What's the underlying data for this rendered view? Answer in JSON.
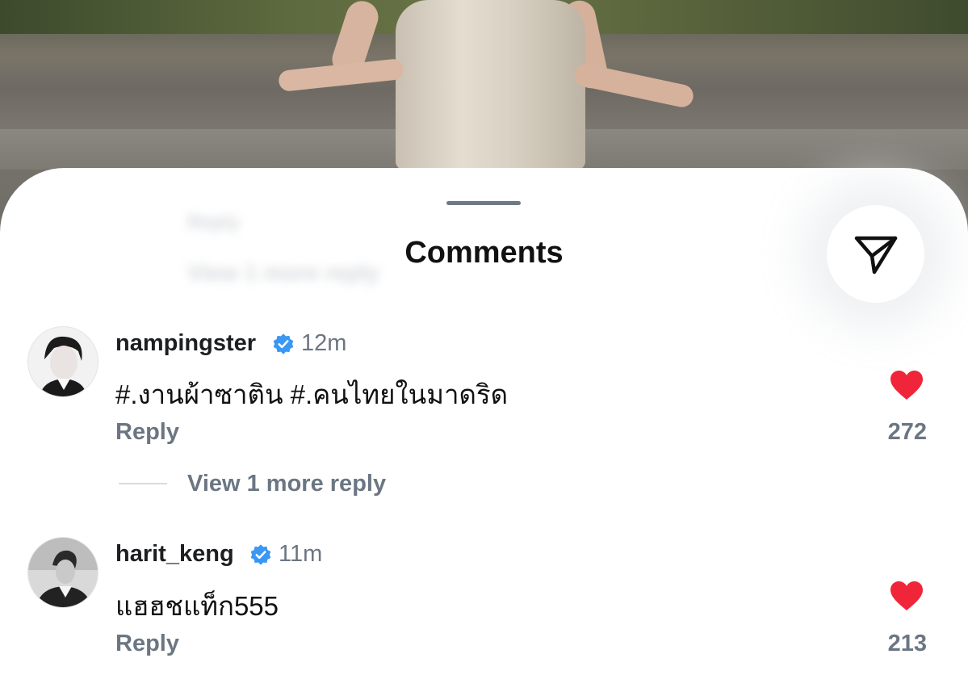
{
  "sheet": {
    "title": "Comments",
    "ghost_reply": "Reply",
    "ghost_more": "View 1 more reply"
  },
  "comments": [
    {
      "username": "nampingster",
      "time": "12m",
      "text": "#.งานผ้าซาติน #.คนไทยในมาดริด",
      "reply_label": "Reply",
      "likes": "272",
      "more_replies": "View 1 more reply"
    },
    {
      "username": "harit_keng",
      "time": "11m",
      "text": "แฮฮชแท็ก555",
      "reply_label": "Reply",
      "likes": "213"
    }
  ],
  "colors": {
    "accent_heart": "#f0253a",
    "verified": "#3a97f3",
    "muted": "#6b7682"
  },
  "icons": [
    "send-icon",
    "verified-badge-icon",
    "heart-icon"
  ]
}
